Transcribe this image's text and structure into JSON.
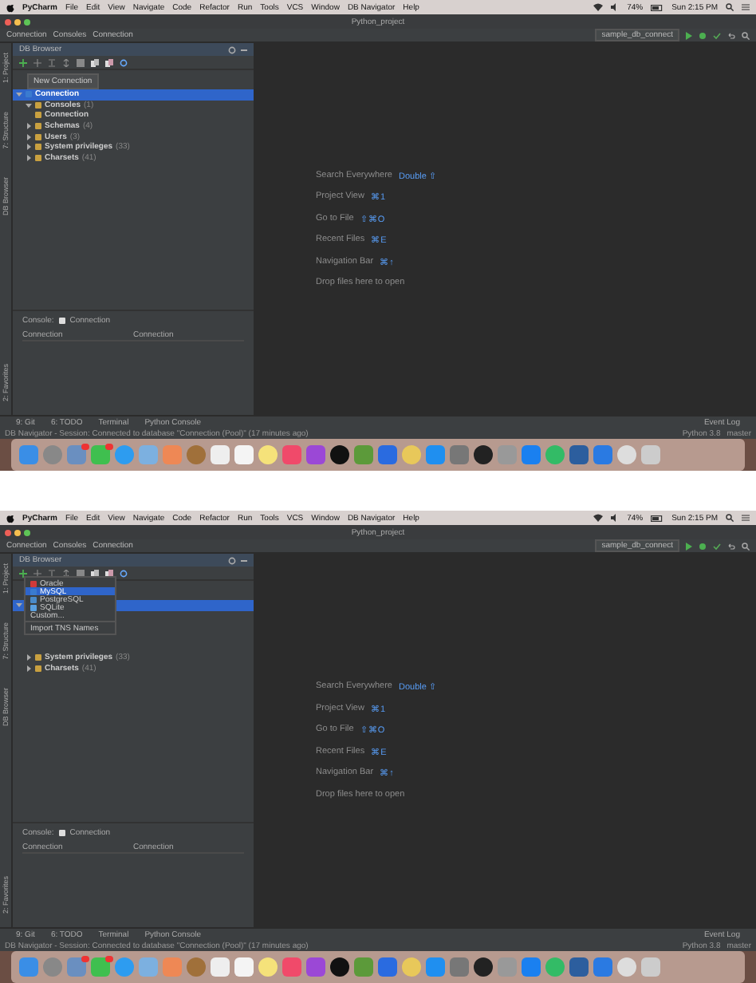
{
  "screens": [
    {
      "menu_bar": {
        "app": "PyCharm",
        "items": [
          "File",
          "Edit",
          "View",
          "Navigate",
          "Code",
          "Refactor",
          "Run",
          "Tools",
          "VCS",
          "Window",
          "DB Navigator",
          "Help"
        ],
        "battery": "74%",
        "clock": "Sun 2:15 PM"
      },
      "window_title": "Python_project",
      "breadcrumbs": [
        "Connection",
        "Consoles",
        "Connection"
      ],
      "run_config": "sample_db_connect",
      "side_tabs": [
        "1: Project",
        "7: Structure",
        "DB Browser",
        "2: Favorites"
      ],
      "panel_title": "DB Browser",
      "tooltip": "New Connection",
      "tree": [
        {
          "label": "Connection",
          "selected": true,
          "expanded": true,
          "children": [
            {
              "label": "Consoles",
              "count": "(1)",
              "expanded": true,
              "children": [
                {
                  "label": "Connection"
                }
              ]
            },
            {
              "label": "Schemas",
              "count": "(4)",
              "expanded": false
            },
            {
              "label": "Users",
              "count": "(3)",
              "expanded": false
            },
            {
              "label": "System privileges",
              "count": "(33)",
              "expanded": false
            },
            {
              "label": "Charsets",
              "count": "(41)",
              "expanded": false
            }
          ]
        }
      ],
      "properties": {
        "label": "Console:",
        "value": "Connection",
        "columns": [
          "Connection",
          "Connection"
        ]
      },
      "hints": [
        {
          "label": "Search Everywhere",
          "shortcut": "Double ⇧"
        },
        {
          "label": "Project View",
          "shortcut": "⌘1"
        },
        {
          "label": "Go to File",
          "shortcut": "⇧⌘O"
        },
        {
          "label": "Recent Files",
          "shortcut": "⌘E"
        },
        {
          "label": "Navigation Bar",
          "shortcut": "⌘↑"
        }
      ],
      "drop_hint": "Drop files here to open",
      "tool_tabs": [
        "9: Git",
        "6: TODO",
        "Terminal",
        "Python Console"
      ],
      "event_log": "Event Log",
      "status": "DB Navigator - Session: Connected to database \"Connection (Pool)\" (17 minutes ago)",
      "interpreter": "Python 3.8",
      "branch": "master"
    },
    {
      "menu_bar": {
        "app": "PyCharm",
        "items": [
          "File",
          "Edit",
          "View",
          "Navigate",
          "Code",
          "Refactor",
          "Run",
          "Tools",
          "VCS",
          "Window",
          "DB Navigator",
          "Help"
        ],
        "battery": "74%",
        "clock": "Sun 2:15 PM"
      },
      "window_title": "Python_project",
      "breadcrumbs": [
        "Connection",
        "Consoles",
        "Connection"
      ],
      "run_config": "sample_db_connect",
      "side_tabs": [
        "1: Project",
        "7: Structure",
        "DB Browser",
        "2: Favorites"
      ],
      "panel_title": "DB Browser",
      "menu": [
        {
          "label": "Oracle",
          "color": "#d03a3a",
          "selected": false
        },
        {
          "label": "MySQL",
          "color": "#3a7bd0",
          "selected": true
        },
        {
          "label": "PostgreSQL",
          "color": "#4a8ac8",
          "selected": false
        },
        {
          "label": "SQLite",
          "color": "#5aa0e0",
          "selected": false
        },
        {
          "label": "Custom...",
          "selected": false
        },
        {
          "label": "Import TNS Names",
          "selected": false
        }
      ],
      "tree": [
        {
          "selected": true,
          "expanded": true,
          "children": [
            {
              "label": "System privileges",
              "count": "(33)",
              "expanded": false
            },
            {
              "label": "Charsets",
              "count": "(41)",
              "expanded": false
            }
          ]
        }
      ],
      "properties": {
        "label": "Console:",
        "value": "Connection",
        "columns": [
          "Connection",
          "Connection"
        ]
      },
      "hints": [
        {
          "label": "Search Everywhere",
          "shortcut": "Double ⇧"
        },
        {
          "label": "Project View",
          "shortcut": "⌘1"
        },
        {
          "label": "Go to File",
          "shortcut": "⇧⌘O"
        },
        {
          "label": "Recent Files",
          "shortcut": "⌘E"
        },
        {
          "label": "Navigation Bar",
          "shortcut": "⌘↑"
        }
      ],
      "drop_hint": "Drop files here to open",
      "tool_tabs": [
        "9: Git",
        "6: TODO",
        "Terminal",
        "Python Console"
      ],
      "event_log": "Event Log",
      "status": "DB Navigator - Session: Connected to database \"Connection (Pool)\" (17 minutes ago)",
      "interpreter": "Python 3.8",
      "branch": "master"
    }
  ]
}
